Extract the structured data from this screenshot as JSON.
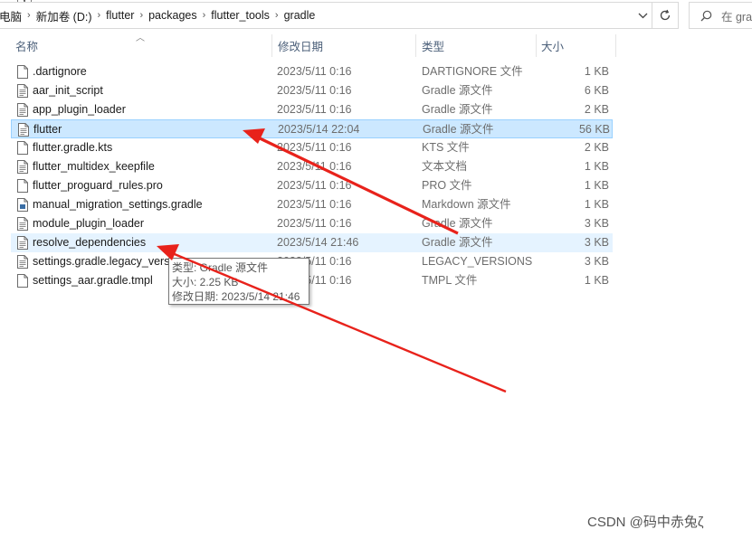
{
  "address": {
    "crumbs": [
      "电脑",
      "新加卷 (D:)",
      "flutter",
      "packages",
      "flutter_tools",
      "gradle"
    ],
    "dropdown_icon": "chevron-down-icon",
    "refresh_icon": "refresh-icon"
  },
  "search": {
    "placeholder": "在 gra",
    "icon": "search-icon"
  },
  "columns": {
    "name": "名称",
    "date": "修改日期",
    "type": "类型",
    "size": "大小"
  },
  "files": [
    {
      "name": ".dartignore",
      "date": "2023/5/11 0:16",
      "type": "DARTIGNORE 文件",
      "size": "1 KB",
      "state": "normal",
      "icon": "file-icon"
    },
    {
      "name": "aar_init_script",
      "date": "2023/5/11 0:16",
      "type": "Gradle 源文件",
      "size": "6 KB",
      "state": "normal",
      "icon": "text-file-icon"
    },
    {
      "name": "app_plugin_loader",
      "date": "2023/5/11 0:16",
      "type": "Gradle 源文件",
      "size": "2 KB",
      "state": "normal",
      "icon": "text-file-icon"
    },
    {
      "name": "flutter",
      "date": "2023/5/14 22:04",
      "type": "Gradle 源文件",
      "size": "56 KB",
      "state": "selected",
      "icon": "text-file-icon"
    },
    {
      "name": "flutter.gradle.kts",
      "date": "2023/5/11 0:16",
      "type": "KTS 文件",
      "size": "2 KB",
      "state": "normal",
      "icon": "file-icon"
    },
    {
      "name": "flutter_multidex_keepfile",
      "date": "2023/5/11 0:16",
      "type": "文本文档",
      "size": "1 KB",
      "state": "normal",
      "icon": "text-file-icon"
    },
    {
      "name": "flutter_proguard_rules.pro",
      "date": "2023/5/11 0:16",
      "type": "PRO 文件",
      "size": "1 KB",
      "state": "normal",
      "icon": "file-icon"
    },
    {
      "name": "manual_migration_settings.gradle",
      "date": "2023/5/11 0:16",
      "type": "Markdown 源文件",
      "size": "1 KB",
      "state": "normal",
      "icon": "markdown-file-icon"
    },
    {
      "name": "module_plugin_loader",
      "date": "2023/5/11 0:16",
      "type": "Gradle 源文件",
      "size": "3 KB",
      "state": "normal",
      "icon": "text-file-icon"
    },
    {
      "name": "resolve_dependencies",
      "date": "2023/5/14 21:46",
      "type": "Gradle 源文件",
      "size": "3 KB",
      "state": "hover",
      "icon": "text-file-icon"
    },
    {
      "name": "settings.gradle.legacy_versions",
      "date": "2023/5/11 0:16",
      "type": "LEGACY_VERSIONS ...",
      "size": "3 KB",
      "state": "normal",
      "icon": "text-file-icon"
    },
    {
      "name": "settings_aar.gradle.tmpl",
      "date": "2023/5/11 0:16",
      "type": "TMPL 文件",
      "size": "1 KB",
      "state": "normal",
      "icon": "file-icon"
    }
  ],
  "tooltip": {
    "line1": "类型: Gradle 源文件",
    "line2": "大小: 2.25 KB",
    "line3": "修改日期: 2023/5/14 21:46"
  },
  "watermark": "CSDN @码中赤兔ζ",
  "colors": {
    "selected_bg": "#cce8ff",
    "hover_bg": "#e5f3ff",
    "arrow": "#e8221b",
    "header_text": "#4c607a"
  }
}
